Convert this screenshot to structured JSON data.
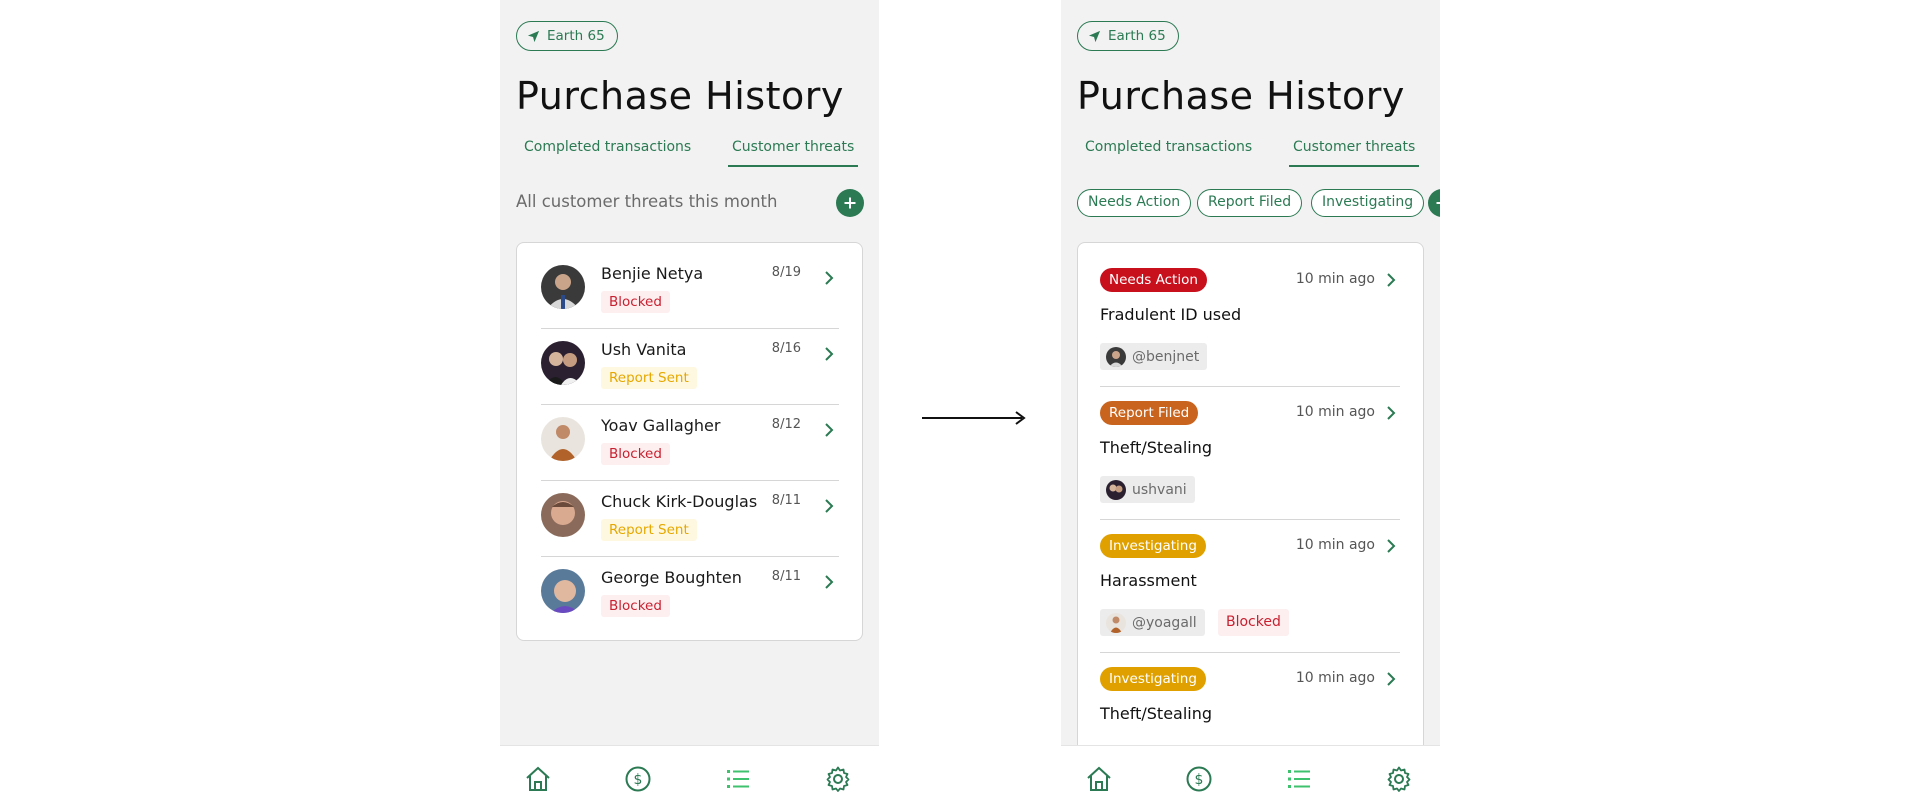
{
  "colors": {
    "brand_green": "#2b7a53",
    "blocked_red": "#c8202f",
    "report_sent_yellow": "#e5a800",
    "needs_action_red": "#c8101d",
    "report_filed_orange": "#c9641e",
    "investigating_yellow": "#e0a100",
    "nav_active_green": "#3fc26e",
    "screen_bg": "#f2f2f2"
  },
  "left_screen": {
    "location_chip": {
      "icon": "location-arrow-icon",
      "label": "Earth 65"
    },
    "title": "Purchase History",
    "tabs": [
      {
        "label": "Completed transactions",
        "active": false
      },
      {
        "label": "Customer threats",
        "active": true
      }
    ],
    "subtitle": "All customer threats this month",
    "add_icon": "plus-icon",
    "threats": [
      {
        "name": "Benjie Netya",
        "date": "8/19",
        "status": "Blocked",
        "status_type": "blocked",
        "avatar_color": "#3a3a3a"
      },
      {
        "name": "Ush Vanita",
        "date": "8/16",
        "status": "Report Sent",
        "status_type": "sent",
        "avatar_color": "#2a2030"
      },
      {
        "name": "Yoav Gallagher",
        "date": "8/12",
        "status": "Blocked",
        "status_type": "blocked",
        "avatar_color": "#b0622a"
      },
      {
        "name": "Chuck Kirk-Douglas",
        "date": "8/11",
        "status": "Report Sent",
        "status_type": "sent",
        "avatar_color": "#a07060"
      },
      {
        "name": "George Boughten",
        "date": "8/11",
        "status": "Blocked",
        "status_type": "blocked",
        "avatar_color": "#5a7a9a"
      }
    ]
  },
  "right_screen": {
    "location_chip": {
      "icon": "location-arrow-icon",
      "label": "Earth 65"
    },
    "title": "Purchase History",
    "tabs": [
      {
        "label": "Completed transactions",
        "active": false
      },
      {
        "label": "Customer threats",
        "active": true
      }
    ],
    "filters": [
      "Needs Action",
      "Report Filed",
      "Investigating"
    ],
    "add_icon": "plus-icon",
    "incidents": [
      {
        "badge": "Needs Action",
        "badge_type": "red",
        "time": "10 min ago",
        "title": "Fradulent ID used",
        "user": "@benjnet",
        "extra": ""
      },
      {
        "badge": "Report Filed",
        "badge_type": "orange",
        "time": "10 min ago",
        "title": "Theft/Stealing",
        "user": "ushvani",
        "extra": ""
      },
      {
        "badge": "Investigating",
        "badge_type": "yellow",
        "time": "10 min ago",
        "title": "Harassment",
        "user": "@yoagall",
        "extra": "Blocked"
      },
      {
        "badge": "Investigating",
        "badge_type": "yellow",
        "time": "10 min ago",
        "title": "Theft/Stealing",
        "user": "",
        "extra": ""
      }
    ]
  },
  "nav": {
    "items": [
      {
        "icon": "home-icon",
        "active": false
      },
      {
        "icon": "dollar-icon",
        "active": false
      },
      {
        "icon": "list-icon",
        "active": true
      },
      {
        "icon": "gear-icon",
        "active": false
      }
    ]
  },
  "transition_icon": "arrow-right-icon"
}
